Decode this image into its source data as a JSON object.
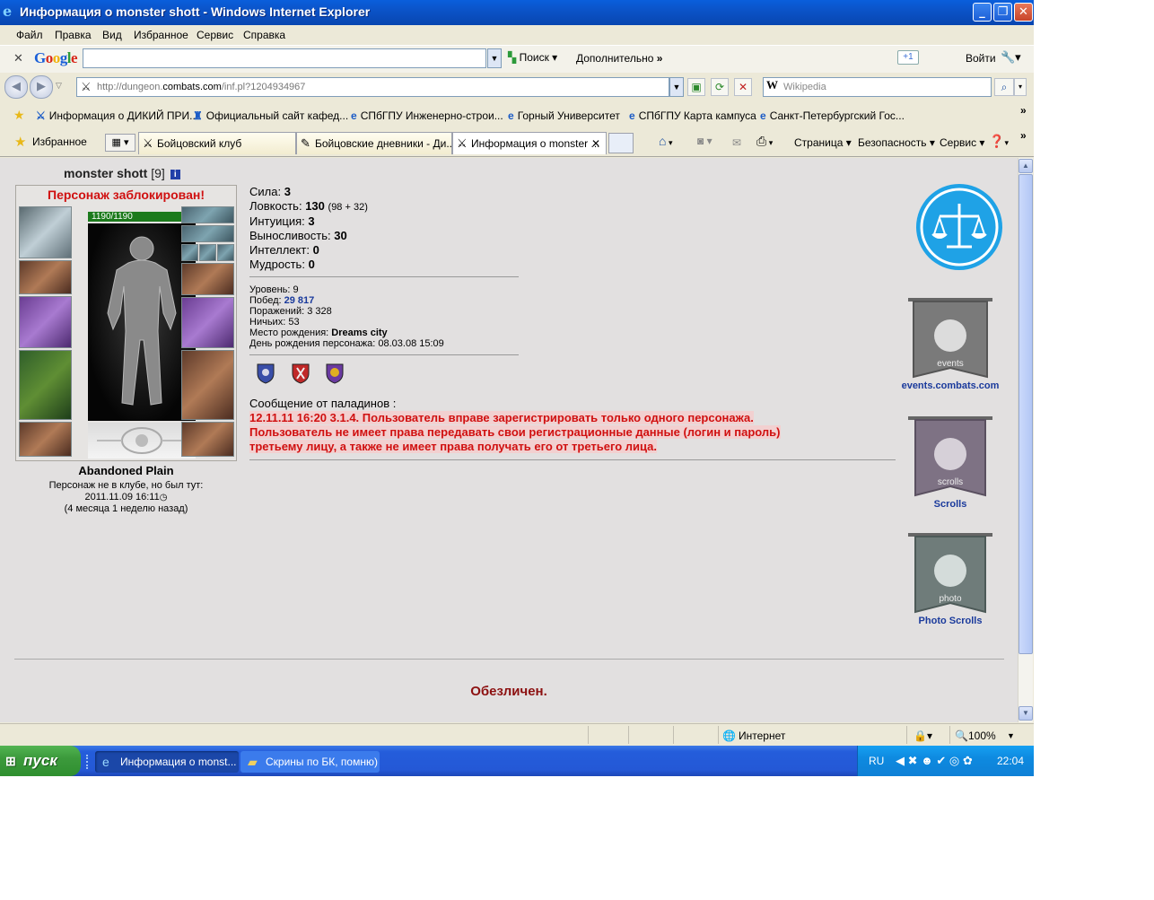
{
  "window": {
    "title": "Информация о monster shott - Windows Internet Explorer",
    "minimize": "_",
    "restore": "❐",
    "close": "✕"
  },
  "menu": [
    "Файл",
    "Правка",
    "Вид",
    "Избранное",
    "Сервис",
    "Справка"
  ],
  "google_toolbar": {
    "logo": "Google",
    "search_value": "",
    "search_label": "Поиск",
    "more_label": "Дополнительно",
    "plus_label": "+1",
    "signin_label": "Войти"
  },
  "address": {
    "url_prefix": "http://dungeon.",
    "url_host": "combats.com",
    "url_path": "/inf.pl?1204934967",
    "wiki_placeholder": "Wikipedia"
  },
  "links": [
    "Информация о ДИКИЙ ПРИ...",
    "Официальный сайт кафед...",
    "СПбГПУ Инженерно-строи...",
    "Горный Университет",
    "СПбГПУ Карта кампуса",
    "Санкт-Петербургский Гос..."
  ],
  "favorites_label": "Избранное",
  "tabs": [
    "Бойцовский клуб",
    "Бойцовские дневники - Ди...",
    "Информация о monster ..."
  ],
  "commands": {
    "page": "Страница",
    "safety": "Безопасность",
    "service": "Сервис"
  },
  "character": {
    "name": "monster shott",
    "level": "[9]",
    "blocked": "Персонаж заблокирован!",
    "hp": "1190/1190",
    "location": "Abandoned Plain",
    "last_seen_line1": "Персонаж не в клубе, но был тут:",
    "last_seen_line2": "2011.11.09 16:11",
    "last_seen_line3": "(4 месяца 1 неделю назад)"
  },
  "stats": [
    {
      "label": "Сила:",
      "value": "3",
      "extra": ""
    },
    {
      "label": "Ловкость:",
      "value": "130",
      "extra": "(98 + 32)"
    },
    {
      "label": "Интуиция:",
      "value": "3",
      "extra": ""
    },
    {
      "label": "Выносливость:",
      "value": "30",
      "extra": ""
    },
    {
      "label": "Интеллект:",
      "value": "0",
      "extra": ""
    },
    {
      "label": "Мудрость:",
      "value": "0",
      "extra": ""
    }
  ],
  "info": {
    "level_label": "Уровень:",
    "level_value": "9",
    "wins_label": "Побед:",
    "wins_value": "29 817",
    "losses_label": "Поражений:",
    "losses_value": "3 328",
    "draws_label": "Ничьих:",
    "draws_value": "53",
    "birthplace_label": "Место рождения:",
    "birthplace_value": "Dreams city",
    "birthday_label": "День рождения персонажа:",
    "birthday_value": "08.03.08 15:09"
  },
  "paladin": {
    "header": "Сообщение от паладинов :",
    "line1": "12.11.11 16:20 3.1.4. Пользователь вправе зарегистрировать только одного персонажа.",
    "line2": "Пользователь не имеет права передавать свои регистрационные данные (логин и пароль)",
    "line3": "третьему лицу, а также не имеет права получать его от третьего лица."
  },
  "banners": {
    "events": "events.combats.com",
    "events_inner": "events",
    "scrolls": "Scrolls",
    "scrolls_inner": "scrolls",
    "photo": "Photo Scrolls",
    "photo_inner": "photo"
  },
  "footer_text": "Обезличен.",
  "status": {
    "zone": "Интернет",
    "zoom": "100%"
  },
  "taskbar": {
    "start": "пуск",
    "task1": "Информация о monst...",
    "task2": "Скрины по БК, помню)",
    "lang": "RU",
    "clock": "22:04"
  },
  "colors": {
    "title_bar": "#0b53c8",
    "blocked_red": "#d01010",
    "footer_red": "#8c1010",
    "link_blue": "#1a3a9c",
    "content_bg": "#e2e0e0"
  }
}
